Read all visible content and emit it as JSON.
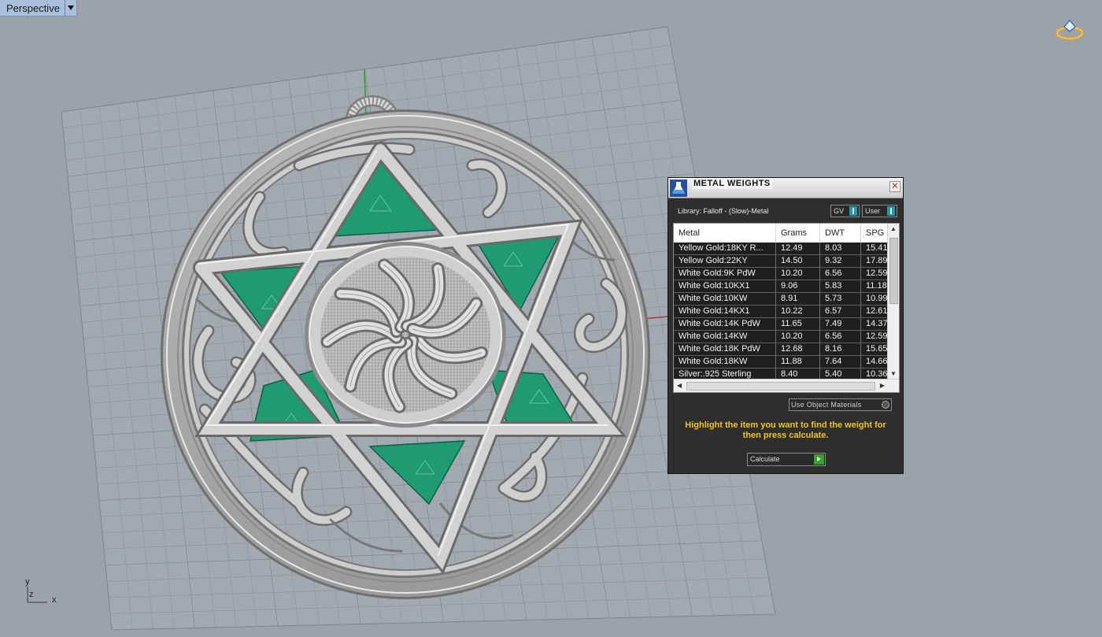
{
  "viewport": {
    "title": "Perspective"
  },
  "axis_labels": {
    "y": "y",
    "z": "z",
    "x": "x"
  },
  "panel": {
    "title": "METAL WEIGHTS",
    "library_label": "Library: Falloff - (Slow)-Metal",
    "gv_toggle": "GV",
    "user_toggle": "User",
    "columns": [
      "Metal",
      "Grams",
      "DWT",
      "SPG"
    ],
    "rows": [
      [
        "Yellow Gold:18KY R...",
        "12.49",
        "8.03",
        "15.41"
      ],
      [
        "Yellow Gold:22KY",
        "14.50",
        "9.32",
        "17.89"
      ],
      [
        "White Gold:9K PdW",
        "10.20",
        "6.56",
        "12.59"
      ],
      [
        "White Gold:10KX1",
        "9.06",
        "5.83",
        "11.18"
      ],
      [
        "White Gold:10KW",
        "8.91",
        "5.73",
        "10.99"
      ],
      [
        "White Gold:14KX1",
        "10.22",
        "6.57",
        "12.61"
      ],
      [
        "White Gold:14K PdW",
        "11.65",
        "7.49",
        "14.37"
      ],
      [
        "White Gold:14KW",
        "10.20",
        "6.56",
        "12.59"
      ],
      [
        "White Gold:18K PdW",
        "12.68",
        "8.16",
        "15.65"
      ],
      [
        "White Gold:18KW",
        "11.88",
        "7.64",
        "14.66"
      ],
      [
        "Silver:.925 Sterling",
        "8.40",
        "5.40",
        "10.36"
      ]
    ],
    "use_object_materials": "Use Object Materials",
    "hint": "Highlight the item you want to find the weight for then press calculate.",
    "calculate": "Calculate"
  },
  "colors": {
    "background": "#9ca2aa",
    "panel": "#2e2e2e",
    "hint": "#f0c61a",
    "gem": "#1f9a72",
    "metal": "#c4c4c4"
  }
}
